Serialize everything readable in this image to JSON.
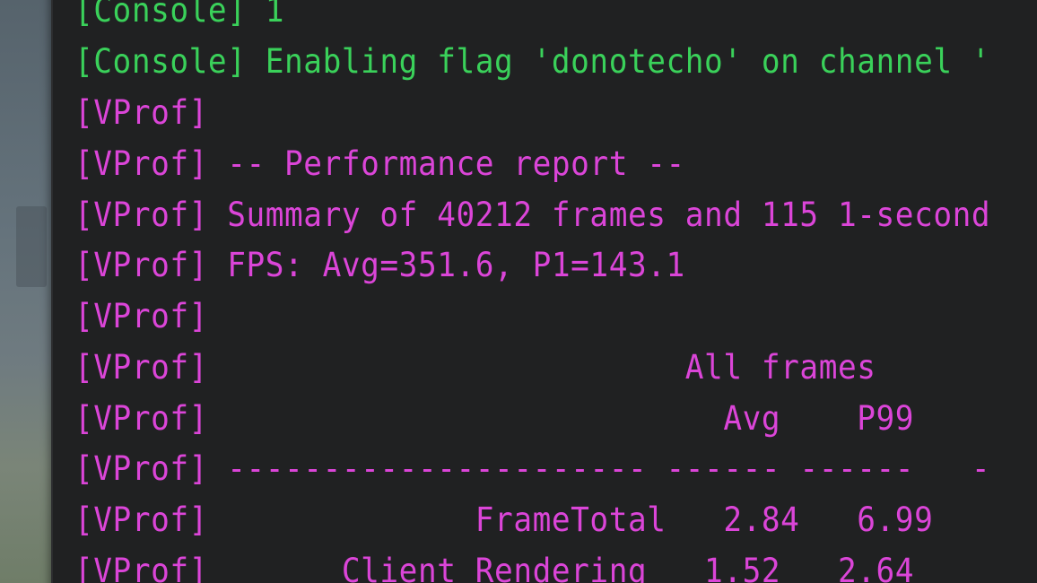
{
  "console": {
    "lines": [
      {
        "text": "[Console] 1",
        "color": "#3ad15a"
      },
      {
        "text": "[Console] Enabling flag 'donotecho' on channel '",
        "color": "#3ad15a"
      },
      {
        "text": "[VProf]",
        "color": "#db45d8"
      },
      {
        "text": "[VProf] -- Performance report --",
        "color": "#db45d8"
      },
      {
        "text": "[VProf] Summary of 40212 frames and 115 1-second",
        "color": "#db45d8"
      },
      {
        "text": "[VProf] FPS: Avg=351.6, P1=143.1",
        "color": "#db45d8"
      },
      {
        "text": "[VProf]",
        "color": "#db45d8"
      },
      {
        "text": "[VProf]                         All frames",
        "color": "#db45d8"
      },
      {
        "text": "[VProf]                           Avg    P99",
        "color": "#db45d8"
      },
      {
        "text": "[VProf] ---------------------- ------ ------   -",
        "color": "#db45d8"
      },
      {
        "text": "[VProf]              FrameTotal   2.84   6.99",
        "color": "#db45d8"
      },
      {
        "text": "[VProf]       Client Rendering   1.52   2.64",
        "color": "#db45d8"
      }
    ]
  }
}
